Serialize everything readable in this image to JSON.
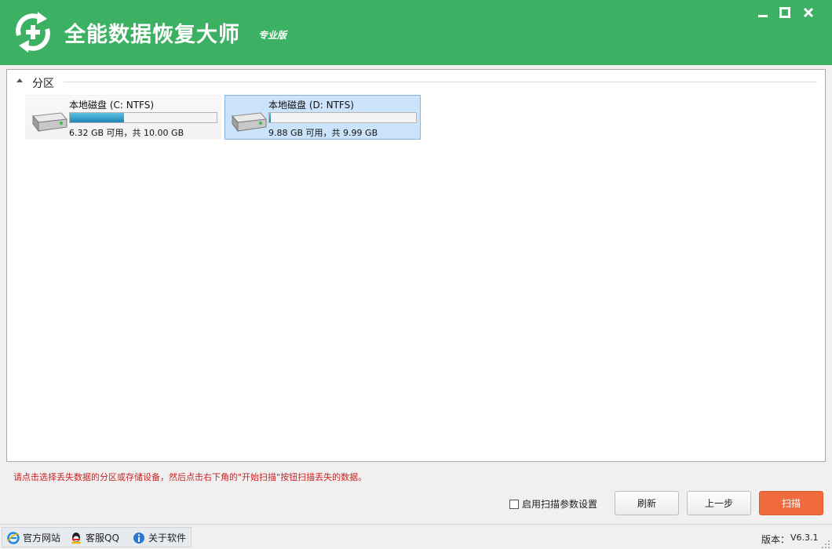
{
  "app": {
    "title": "全能数据恢复大师",
    "edition": "专业版",
    "accent_color": "#3cb063"
  },
  "window_controls": [
    "minimize-icon",
    "maximize-icon",
    "close-icon"
  ],
  "partitions": {
    "group_label": "分区",
    "disks": [
      {
        "name": "本地磁盘 (C: NTFS)",
        "free_text": "6.32 GB 可用，共 10.00 GB",
        "used_fraction": 0.368,
        "selected": false
      },
      {
        "name": "本地磁盘 (D: NTFS)",
        "free_text": "9.88 GB 可用，共 9.99 GB",
        "used_fraction": 0.011,
        "selected": true
      }
    ]
  },
  "hint": "请点击选择丢失数据的分区或存储设备，然后点击右下角的\"开始扫描\"按钮扫描丢失的数据。",
  "options": {
    "scan_params_label": "启用扫描参数设置",
    "scan_params_checked": false
  },
  "buttons": {
    "refresh": "刷新",
    "prev": "上一步",
    "scan": "扫描"
  },
  "status": {
    "links": [
      {
        "label": "官方网站",
        "icon": "ie-icon"
      },
      {
        "label": "客服QQ",
        "icon": "qq-icon"
      },
      {
        "label": "关于软件",
        "icon": "info-icon"
      }
    ],
    "version_label": "版本：",
    "version_value": "V6.3.1"
  }
}
